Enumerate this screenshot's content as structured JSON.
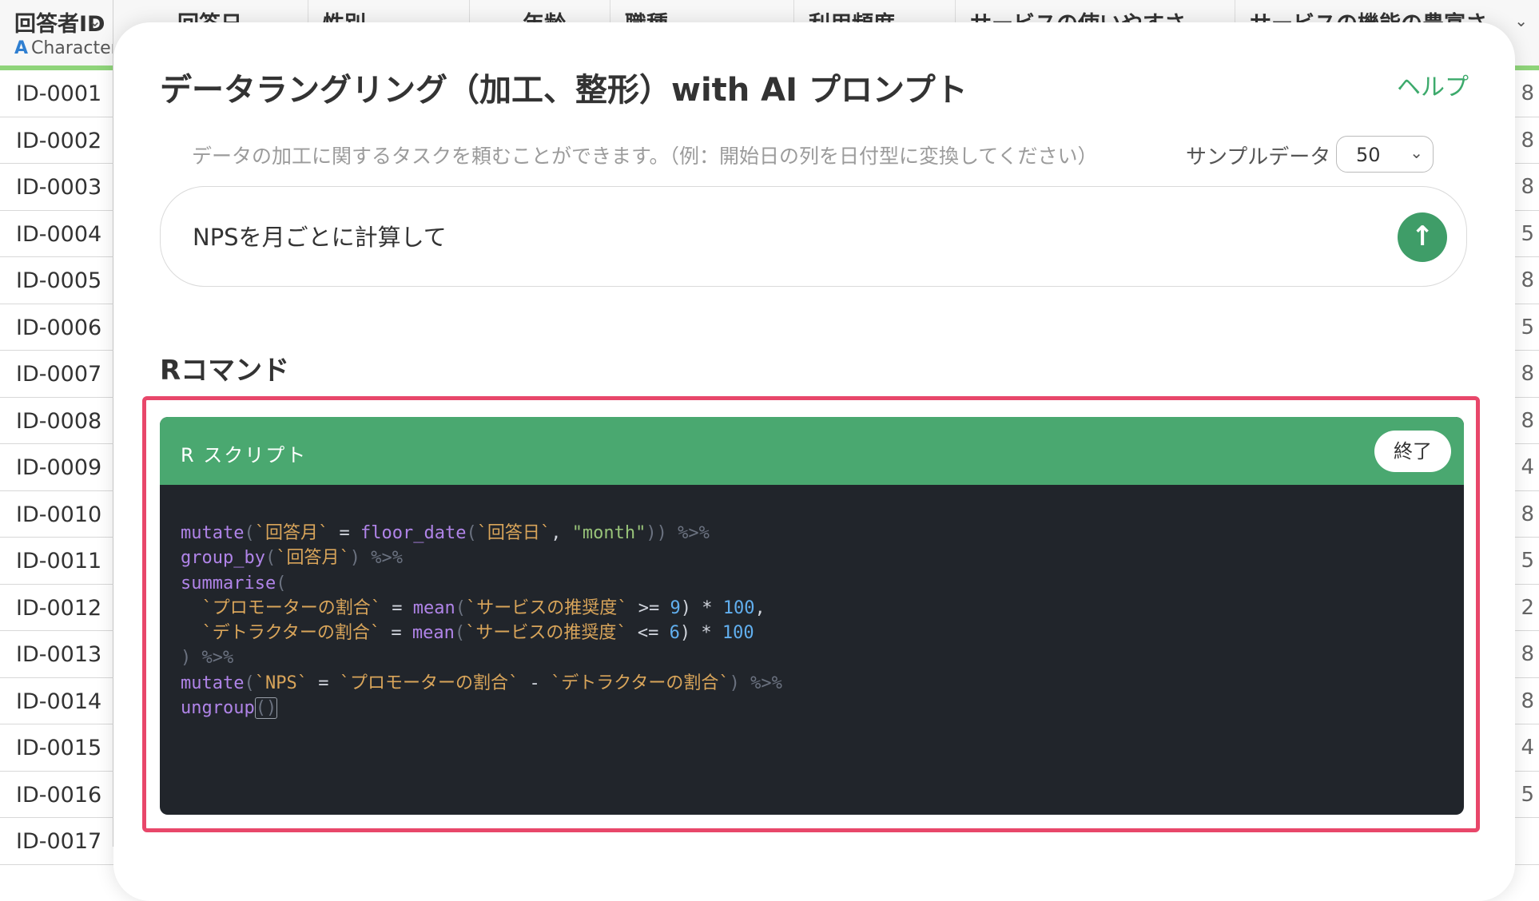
{
  "spreadsheet": {
    "columns": [
      {
        "title": "回答者ID",
        "type_icon": "A",
        "type_label": "Character"
      },
      {
        "title": "回答日"
      },
      {
        "title": "性別"
      },
      {
        "title": "年齢"
      },
      {
        "title": "職種"
      },
      {
        "title": "利用頻度"
      },
      {
        "title": "サービスの使いやすさ"
      },
      {
        "title": "サービスの機能の豊富さ"
      }
    ],
    "row_ids": [
      "ID-0001",
      "ID-0002",
      "ID-0003",
      "ID-0004",
      "ID-0005",
      "ID-0006",
      "ID-0007",
      "ID-0008",
      "ID-0009",
      "ID-0010",
      "ID-0011",
      "ID-0012",
      "ID-0013",
      "ID-0014",
      "ID-0015",
      "ID-0016",
      "ID-0017"
    ],
    "edge_values": [
      "8",
      "8",
      "8",
      "5",
      "8",
      "5",
      "8",
      "8",
      "4",
      "8",
      "5",
      "2",
      "8",
      "8",
      "4",
      "5",
      ""
    ]
  },
  "modal": {
    "title": "データラングリング（加工、整形）with AI プロンプト",
    "help_label": "ヘルプ",
    "hint": "データの加工に関するタスクを頼むことができます。（例：開始日の列を日付型に変換してください）",
    "sample_label": "サンプルデータ",
    "sample_value": "50",
    "prompt_value": "NPSを月ごとに計算して",
    "section_title": "Rコマンド",
    "script_title": "R スクリプト",
    "close_label": "終了"
  },
  "code": {
    "l1": {
      "fn": "mutate",
      "a": "(",
      "s1": "`回答月`",
      "b": " = ",
      "fn2": "floor_date",
      "c": "(",
      "s2": "`回答日`",
      "d": ", ",
      "q": "\"month\"",
      "e": ")) ",
      "p": "%>%"
    },
    "l2": {
      "fn": "group_by",
      "a": "(",
      "s1": "`回答月`",
      "e": ") ",
      "p": "%>%"
    },
    "l3": {
      "fn": "summarise",
      "a": "("
    },
    "l4": {
      "ind": "  ",
      "s1": "`プロモーターの割合`",
      "b": " = ",
      "fn": "mean",
      "c": "(",
      "s2": "`サービスの推奨度`",
      "d": " >= ",
      "n1": "9",
      "e": ") * ",
      "n2": "100",
      "f": ","
    },
    "l5": {
      "ind": "  ",
      "s1": "`デトラクターの割合`",
      "b": " = ",
      "fn": "mean",
      "c": "(",
      "s2": "`サービスの推奨度`",
      "d": " <= ",
      "n1": "6",
      "e": ") * ",
      "n2": "100"
    },
    "l6": {
      "a": ") ",
      "p": "%>%"
    },
    "l7": {
      "fn": "mutate",
      "a": "(",
      "s1": "`NPS`",
      "b": " = ",
      "s2": "`プロモーターの割合`",
      "d": " - ",
      "s3": "`デトラクターの割合`",
      "e": ") ",
      "p": "%>%"
    },
    "l8": {
      "fn": "ungroup",
      "a": "()"
    }
  },
  "colors": {
    "accent_green": "#4aa870",
    "send_button": "#3f9d68",
    "highlight_frame": "#e8476a",
    "code_background": "#21252b"
  }
}
